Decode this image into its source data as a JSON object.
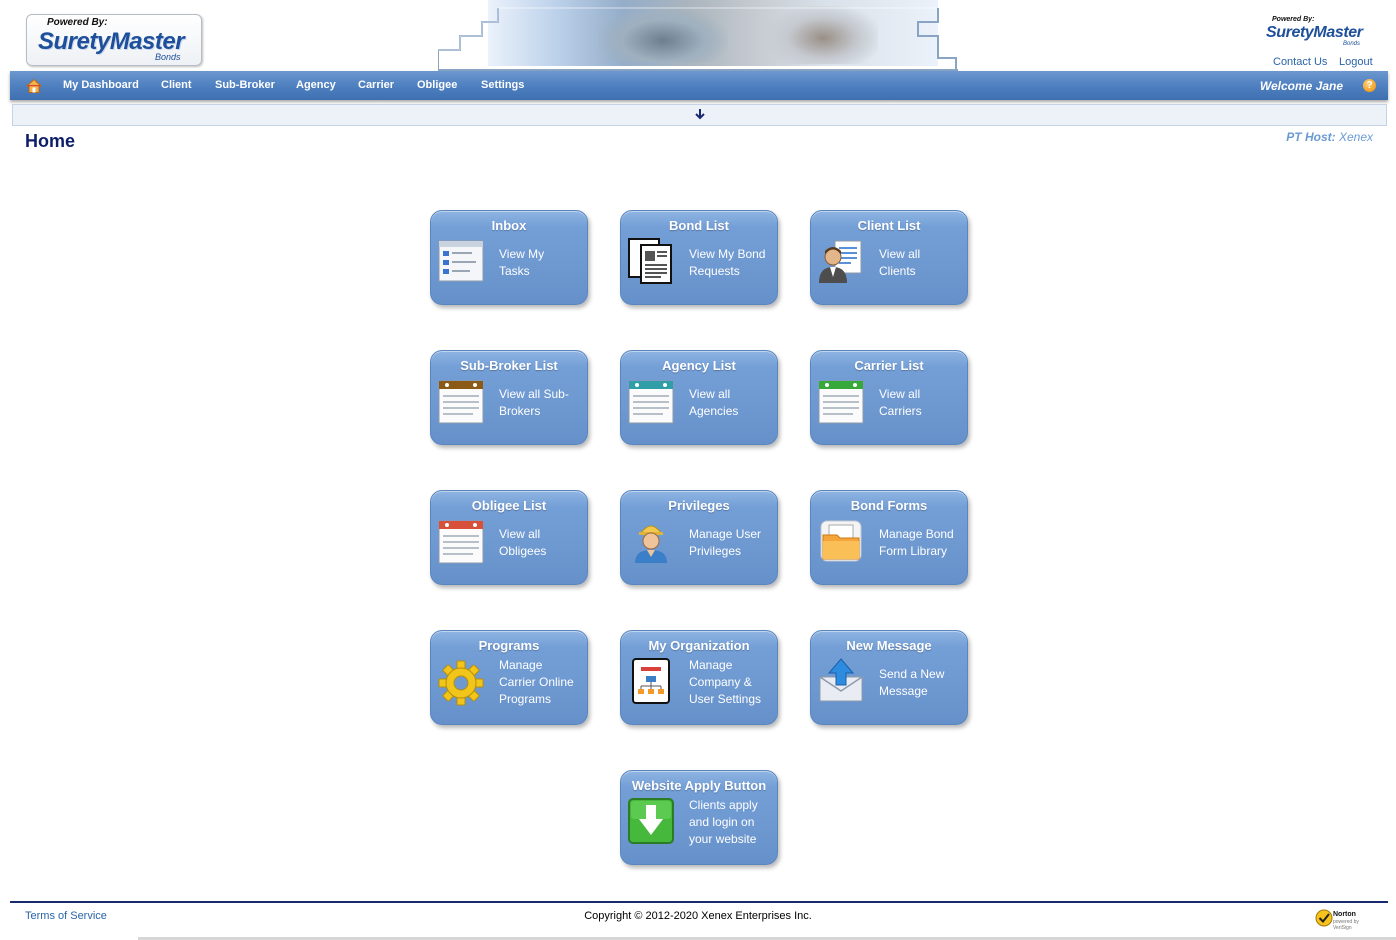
{
  "header": {
    "logo": {
      "powered_by": "Powered By:",
      "name": "SuretyMaster",
      "sub": "Bonds"
    },
    "logo_small": {
      "powered_by": "Powered By:",
      "name": "SuretyMaster",
      "sub": "Bonds"
    },
    "links": {
      "contact": "Contact Us",
      "logout": "Logout"
    }
  },
  "nav": {
    "items": [
      "My Dashboard",
      "Client",
      "Sub-Broker",
      "Agency",
      "Carrier",
      "Obligee",
      "Settings"
    ],
    "welcome": "Welcome Jane",
    "help": "?"
  },
  "page": {
    "title": "Home",
    "pt_host_label": "PT Host:",
    "pt_host_value": "Xenex"
  },
  "tiles": [
    {
      "title": "Inbox",
      "lines": [
        "View My",
        "Tasks"
      ],
      "icon": "inbox-tasks-icon"
    },
    {
      "title": "Bond List",
      "lines": [
        "View My Bond",
        "Requests"
      ],
      "icon": "documents-icon"
    },
    {
      "title": "Client List",
      "lines": [
        "View all",
        "Clients"
      ],
      "icon": "client-user-icon"
    },
    {
      "title": "Sub-Broker List",
      "lines": [
        "View all Sub-",
        "Brokers"
      ],
      "icon": "calendar-list-icon"
    },
    {
      "title": "Agency List",
      "lines": [
        "View all",
        "Agencies"
      ],
      "icon": "calendar-list-icon"
    },
    {
      "title": "Carrier List",
      "lines": [
        "View all",
        "Carriers"
      ],
      "icon": "calendar-list-icon"
    },
    {
      "title": "Obligee List",
      "lines": [
        "View all",
        "Obligees"
      ],
      "icon": "calendar-list-icon"
    },
    {
      "title": "Privileges",
      "lines": [
        "Manage User",
        "Privileges"
      ],
      "icon": "worker-user-icon"
    },
    {
      "title": "Bond Forms",
      "lines": [
        "Manage Bond",
        "Form Library"
      ],
      "icon": "folder-icon"
    },
    {
      "title": "Programs",
      "lines": [
        "Manage",
        "Carrier Online",
        "Programs"
      ],
      "icon": "gear-icon"
    },
    {
      "title": "My Organization",
      "lines": [
        "Manage",
        "Company &",
        "User Settings"
      ],
      "icon": "org-chart-icon"
    },
    {
      "title": "New Message",
      "lines": [
        "Send a New",
        "Message"
      ],
      "icon": "envelope-upload-icon"
    },
    {
      "title": "Website Apply Button",
      "lines": [
        "Clients apply",
        "and login on",
        "your website"
      ],
      "icon": "download-arrow-icon"
    }
  ],
  "footer": {
    "terms": "Terms of Service",
    "copyright": "Copyright © 2012-2020 Xenex Enterprises Inc.",
    "badge": {
      "name": "Norton",
      "sub": "powered by VeriSign"
    }
  },
  "colors": {
    "nav_blue": "#4f80c0",
    "tile_blue": "#739ed6",
    "title_navy": "#0e1f6a",
    "link_blue": "#2a64a8"
  }
}
